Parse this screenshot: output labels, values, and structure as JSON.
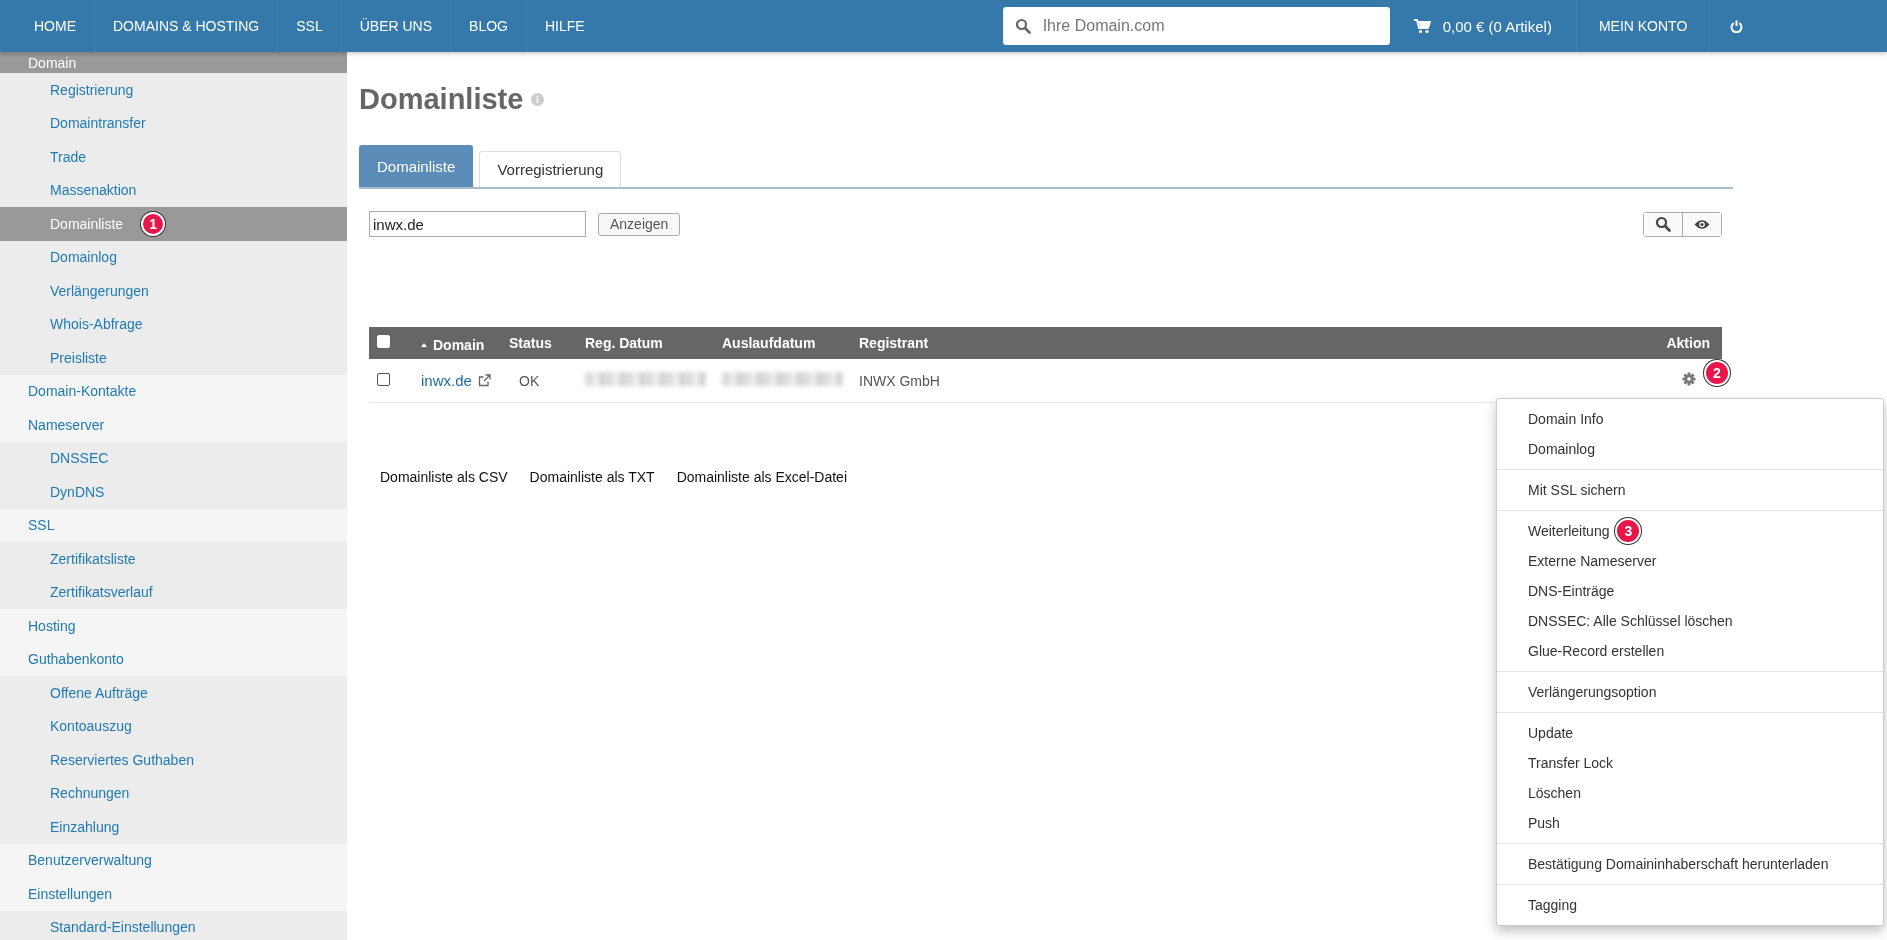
{
  "nav": {
    "items": [
      {
        "label": "HOME"
      },
      {
        "label": "DOMAINS & HOSTING"
      },
      {
        "label": "SSL"
      },
      {
        "label": "ÜBER UNS"
      },
      {
        "label": "BLOG"
      },
      {
        "label": "HILFE"
      }
    ],
    "search": {
      "placeholder": "Ihre Domain.com"
    },
    "cart": "0,00 € (0 Artikel)",
    "account": "MEIN KONTO"
  },
  "sidebar": {
    "items": [
      {
        "label": "Domain",
        "selected": true,
        "children": [
          {
            "label": "Registrierung",
            "selected": false
          },
          {
            "label": "Domaintransfer",
            "selected": false
          },
          {
            "label": "Trade",
            "selected": false
          },
          {
            "label": "Massenaktion",
            "selected": false
          },
          {
            "label": "Domainliste",
            "selected": true,
            "badge": "1"
          },
          {
            "label": "Domainlog",
            "selected": false
          },
          {
            "label": "Verlängerungen",
            "selected": false
          },
          {
            "label": "Whois-Abfrage",
            "selected": false
          },
          {
            "label": "Preisliste",
            "selected": false
          }
        ]
      },
      {
        "label": "Domain-Kontakte",
        "selected": false
      },
      {
        "label": "Nameserver",
        "selected": false,
        "children": [
          {
            "label": "DNSSEC",
            "selected": false
          },
          {
            "label": "DynDNS",
            "selected": false
          }
        ]
      },
      {
        "label": "SSL",
        "selected": false,
        "children": [
          {
            "label": "Zertifikatsliste",
            "selected": false
          },
          {
            "label": "Zertifikatsverlauf",
            "selected": false
          }
        ]
      },
      {
        "label": "Hosting",
        "selected": false
      },
      {
        "label": "Guthabenkonto",
        "selected": false,
        "children": [
          {
            "label": "Offene Aufträge",
            "selected": false
          },
          {
            "label": "Kontoauszug",
            "selected": false
          },
          {
            "label": "Reserviertes Guthaben",
            "selected": false
          },
          {
            "label": "Rechnungen",
            "selected": false
          },
          {
            "label": "Einzahlung",
            "selected": false
          }
        ]
      },
      {
        "label": "Benutzerverwaltung",
        "selected": false
      },
      {
        "label": "Einstellungen",
        "selected": false,
        "children": [
          {
            "label": "Standard-Einstellungen",
            "selected": false
          }
        ]
      }
    ]
  },
  "page": {
    "title": "Domainliste"
  },
  "tabs": [
    {
      "label": "Domainliste",
      "selected": true
    },
    {
      "label": "Vorregistrierung",
      "selected": false
    }
  ],
  "filter": {
    "value": "inwx.de",
    "button": "Anzeigen"
  },
  "table": {
    "select_all_checked": false,
    "columns": [
      {
        "label": "Domain",
        "sorted": true
      },
      {
        "label": "Status",
        "sorted": false
      },
      {
        "label": "Reg. Datum",
        "sorted": false
      },
      {
        "label": "Auslaufdatum",
        "sorted": false
      },
      {
        "label": "Registrant",
        "sorted": false
      },
      {
        "label": "Aktion",
        "sorted": false
      }
    ],
    "rows": [
      {
        "checked": false,
        "domain": "inwx.de",
        "status": "OK",
        "registrant": "INWX GmbH",
        "badge": "2"
      }
    ]
  },
  "exports": [
    "Domainliste als CSV",
    "Domainliste als TXT",
    "Domainliste als Excel-Datei"
  ],
  "action_menu": {
    "groups": [
      {
        "items": [
          {
            "label": "Domain Info"
          },
          {
            "label": "Domainlog"
          }
        ]
      },
      {
        "items": [
          {
            "label": "Mit SSL sichern"
          }
        ]
      },
      {
        "items": [
          {
            "label": "Weiterleitung",
            "badge": "3"
          },
          {
            "label": "Externe Nameserver"
          },
          {
            "label": "DNS-Einträge"
          },
          {
            "label": "DNSSEC: Alle Schlüssel löschen"
          },
          {
            "label": "Glue-Record erstellen"
          }
        ]
      },
      {
        "items": [
          {
            "label": "Verlängerungsoption"
          }
        ]
      },
      {
        "items": [
          {
            "label": "Update"
          },
          {
            "label": "Transfer Lock"
          },
          {
            "label": "Löschen"
          },
          {
            "label": "Push"
          }
        ]
      },
      {
        "items": [
          {
            "label": "Bestätigung Domaininhaberschaft herunterladen"
          }
        ]
      },
      {
        "items": [
          {
            "label": "Tagging"
          }
        ]
      }
    ]
  }
}
